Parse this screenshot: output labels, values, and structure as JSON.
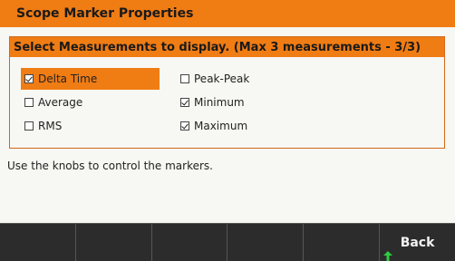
{
  "window": {
    "title": "Scope Marker Properties"
  },
  "panel": {
    "header": "Select Measurements to display. (Max 3 measurements - 3/3)",
    "options": [
      {
        "label": "Delta Time",
        "checked": true,
        "selected": true
      },
      {
        "label": "Average",
        "checked": false,
        "selected": false
      },
      {
        "label": "RMS",
        "checked": false,
        "selected": false
      },
      {
        "label": "Peak-Peak",
        "checked": false,
        "selected": false
      },
      {
        "label": "Minimum",
        "checked": true,
        "selected": false
      },
      {
        "label": "Maximum",
        "checked": true,
        "selected": false
      }
    ]
  },
  "hint": "Use the knobs to control the markers.",
  "softkeys": [
    "",
    "",
    "",
    "",
    "",
    "Back"
  ],
  "colors": {
    "accent": "#f07c14",
    "softkey_bg": "#2c2c2c",
    "arrow": "#2ecc40"
  },
  "icons": {
    "return": "arrow-up-icon"
  }
}
